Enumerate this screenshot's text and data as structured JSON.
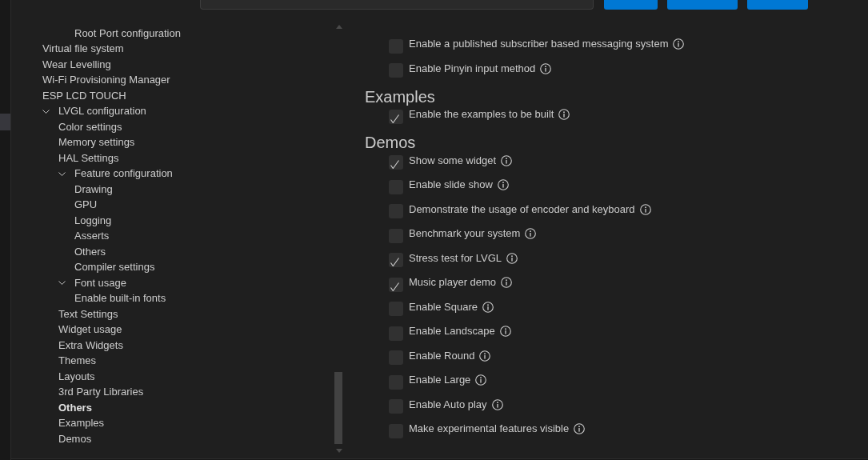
{
  "tree": {
    "items": [
      {
        "children": [
          {
            "children": [
              {
                "label": "Root Port configuration",
                "selected": false
              }
            ]
          }
        ]
      },
      {
        "label": "Virtual file system",
        "selected": false
      },
      {
        "label": "Wear Levelling",
        "selected": false
      },
      {
        "label": "Wi-Fi Provisioning Manager",
        "selected": false
      },
      {
        "label": "ESP LCD TOUCH",
        "selected": false
      },
      {
        "label": "LVGL configuration",
        "selected": false,
        "expanded": true,
        "children": [
          {
            "label": "Color settings",
            "selected": false
          },
          {
            "label": "Memory settings",
            "selected": false
          },
          {
            "label": "HAL Settings",
            "selected": false
          },
          {
            "label": "Feature configuration",
            "selected": false,
            "expanded": true,
            "children": [
              {
                "label": "Drawing",
                "selected": false
              },
              {
                "label": "GPU",
                "selected": false
              },
              {
                "label": "Logging",
                "selected": false
              },
              {
                "label": "Asserts",
                "selected": false
              },
              {
                "label": "Others",
                "selected": false
              },
              {
                "label": "Compiler settings",
                "selected": false
              }
            ]
          },
          {
            "label": "Font usage",
            "selected": false,
            "expanded": true,
            "children": [
              {
                "label": "Enable built-in fonts",
                "selected": false
              }
            ]
          },
          {
            "label": "Text Settings",
            "selected": false
          },
          {
            "label": "Widget usage",
            "selected": false
          },
          {
            "label": "Extra Widgets",
            "selected": false
          },
          {
            "label": "Themes",
            "selected": false
          },
          {
            "label": "Layouts",
            "selected": false
          },
          {
            "label": "3rd Party Libraries",
            "selected": false
          },
          {
            "label": "Others",
            "selected": true
          },
          {
            "label": "Examples",
            "selected": false
          },
          {
            "label": "Demos",
            "selected": false
          }
        ]
      }
    ]
  },
  "settings": {
    "sections": [
      {
        "items": [
          {
            "label": "Enable a published subscriber based messaging system",
            "checked": false
          },
          {
            "label": "Enable Pinyin input method",
            "checked": false
          }
        ]
      },
      {
        "title": "Examples",
        "items": [
          {
            "label": "Enable the examples to be built",
            "checked": true
          }
        ]
      },
      {
        "title": "Demos",
        "items": [
          {
            "label": "Show some widget",
            "checked": true
          },
          {
            "label": "Enable slide show",
            "checked": false
          },
          {
            "label": "Demonstrate the usage of encoder and keyboard",
            "checked": false
          },
          {
            "label": "Benchmark your system",
            "checked": false
          },
          {
            "label": "Stress test for LVGL",
            "checked": true
          },
          {
            "label": "Music player demo",
            "checked": true
          },
          {
            "label": "Enable Square",
            "checked": false
          },
          {
            "label": "Enable Landscape",
            "checked": false
          },
          {
            "label": "Enable Round",
            "checked": false
          },
          {
            "label": "Enable Large",
            "checked": false
          },
          {
            "label": "Enable Auto play",
            "checked": false
          },
          {
            "label": "Make experimental features visible",
            "checked": false
          }
        ]
      }
    ]
  }
}
